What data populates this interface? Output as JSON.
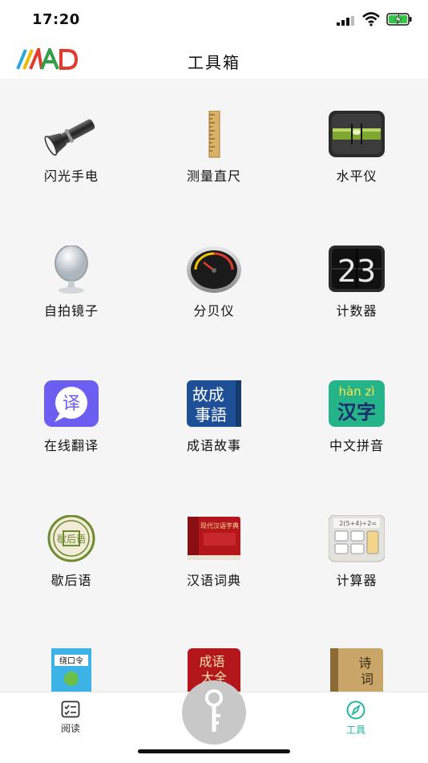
{
  "status": {
    "time": "17:20"
  },
  "header": {
    "title": "工具箱",
    "logo_text": "MAD"
  },
  "tools": [
    {
      "label": "闪光手电",
      "icon": "flashlight-icon"
    },
    {
      "label": "测量直尺",
      "icon": "ruler-icon"
    },
    {
      "label": "水平仪",
      "icon": "level-icon"
    },
    {
      "label": "自拍镜子",
      "icon": "mirror-icon"
    },
    {
      "label": "分贝仪",
      "icon": "decibel-meter-icon"
    },
    {
      "label": "计数器",
      "icon": "counter-icon"
    },
    {
      "label": "在线翻译",
      "icon": "translate-icon"
    },
    {
      "label": "成语故事",
      "icon": "idiom-story-icon"
    },
    {
      "label": "中文拼音",
      "icon": "pinyin-icon"
    },
    {
      "label": "歇后语",
      "icon": "xiehouyu-icon"
    },
    {
      "label": "汉语词典",
      "icon": "dictionary-icon"
    },
    {
      "label": "计算器",
      "icon": "calculator-icon"
    },
    {
      "label": "",
      "icon": "tongue-twister-book-icon"
    },
    {
      "label": "",
      "icon": "idiom-encyclopedia-icon"
    },
    {
      "label": "",
      "icon": "poetry-book-icon"
    }
  ],
  "icon_text": {
    "counter": "23",
    "translate": "译",
    "idiom_story": "故成事語",
    "pinyin_top": "hàn zì",
    "pinyin_bottom": "汉字",
    "xiehouyu": "歇后语",
    "dictionary": "现代汉语字典",
    "calc_expr": "2(5+4)÷2=",
    "twister": "绕口令",
    "idiom_big": "成语大全",
    "poetry": "诗词"
  },
  "tabbar": {
    "read_label": "阅读",
    "tools_label": "工具",
    "active_color": "#1fb89a"
  }
}
